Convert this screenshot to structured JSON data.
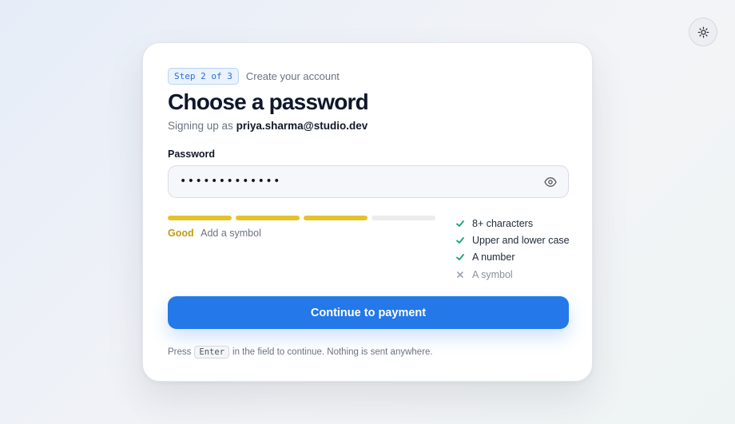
{
  "theme_toggle": {
    "icon": "sun-icon"
  },
  "step": {
    "badge": "Step 2 of 3",
    "text": "Create your account"
  },
  "title": "Choose a password",
  "signup": {
    "prefix": "Signing up as",
    "email": "priya.sharma@studio.dev"
  },
  "password": {
    "label": "Password",
    "masked_value": "•••••••••••••",
    "toggle_icon": "eye-icon"
  },
  "strength": {
    "segments_filled": 3,
    "segments_total": 4,
    "level": "Good",
    "hint": "Add a symbol",
    "color": "#e5c22b"
  },
  "requirements": [
    {
      "label": "8+ characters",
      "met": true
    },
    {
      "label": "Upper and lower case",
      "met": true
    },
    {
      "label": "A number",
      "met": true
    },
    {
      "label": "A symbol",
      "met": false
    }
  ],
  "cta": {
    "label": "Continue to payment",
    "color": "#2478e8"
  },
  "footer": {
    "prefix": "Press",
    "key": "Enter",
    "suffix": "in the field to continue. Nothing is sent anywhere."
  }
}
